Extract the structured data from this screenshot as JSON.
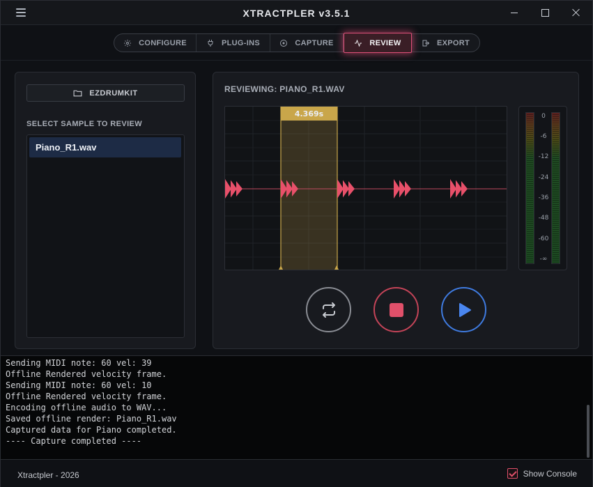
{
  "titlebar": {
    "title": "XTRACTPLER v3.5.1"
  },
  "nav": {
    "items": [
      {
        "label": "CONFIGURE",
        "icon": "gear-icon"
      },
      {
        "label": "PLUG-INS",
        "icon": "plug-icon"
      },
      {
        "label": "CAPTURE",
        "icon": "record-icon"
      },
      {
        "label": "REVIEW",
        "icon": "waveform-icon",
        "active": true
      },
      {
        "label": "EXPORT",
        "icon": "export-icon"
      }
    ]
  },
  "left": {
    "kit_button": "EZDRUMKIT",
    "select_label": "SELECT SAMPLE TO REVIEW",
    "samples": [
      "Piano_R1.wav"
    ]
  },
  "right": {
    "reviewing": "REVIEWING: PIANO_R1.WAV",
    "selection_label": "4.369s",
    "meter_ticks": [
      "0",
      "-6",
      "-12",
      "-24",
      "-36",
      "-48",
      "-60",
      "-∞"
    ]
  },
  "console": {
    "lines": [
      "Sending MIDI note: 60 vel: 39",
      "Offline Rendered velocity frame.",
      "Sending MIDI note: 60 vel: 10",
      "Offline Rendered velocity frame.",
      "Encoding offline audio to WAV...",
      "Saved offline render: Piano_R1.wav",
      "Captured data for Piano completed.",
      "---- Capture completed ----"
    ]
  },
  "footer": {
    "left": "Xtractpler - 2026",
    "show_console_label": "Show Console",
    "show_console_checked": true
  },
  "colors": {
    "accent": "#e0507a",
    "waveform": "#e8506a",
    "selection": "#c9a64a",
    "play": "#3f7be0",
    "stop": "#c44458"
  }
}
